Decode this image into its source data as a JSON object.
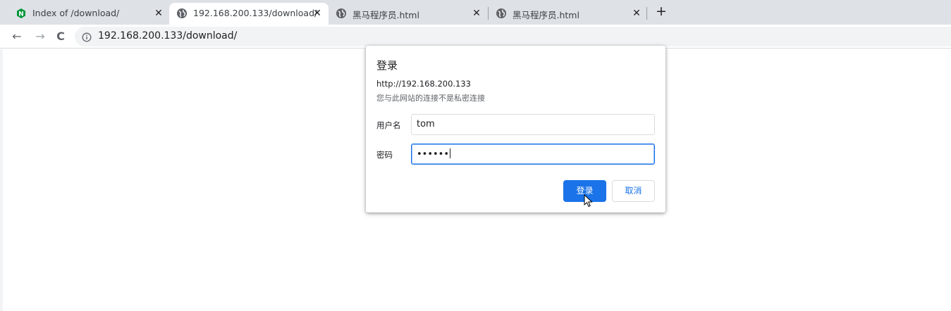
{
  "tabs": [
    {
      "title": "Index of /download/",
      "favicon": "nginx-icon",
      "active": false
    },
    {
      "title": "192.168.200.133/download/",
      "favicon": "globe-icon",
      "active": true
    },
    {
      "title": "黑马程序员.html",
      "favicon": "globe-icon",
      "active": false
    },
    {
      "title": "黑马程序员.html",
      "favicon": "globe-icon",
      "active": false
    }
  ],
  "tab_close_glyph": "✕",
  "new_tab_glyph": "+",
  "toolbar": {
    "back_glyph": "←",
    "forward_glyph": "→",
    "reload_glyph": "C",
    "url": "192.168.200.133/download/"
  },
  "dialog": {
    "title": "登录",
    "url": "http://192.168.200.133",
    "note": "您与此网站的连接不是私密连接",
    "username_label": "用户名",
    "username_value": "tom",
    "password_label": "密码",
    "password_value": "••••••",
    "login_button": "登录",
    "cancel_button": "取消"
  },
  "colors": {
    "accent": "#1a73e8",
    "tabstrip": "#dee1e6",
    "nginx_green": "#009639"
  }
}
